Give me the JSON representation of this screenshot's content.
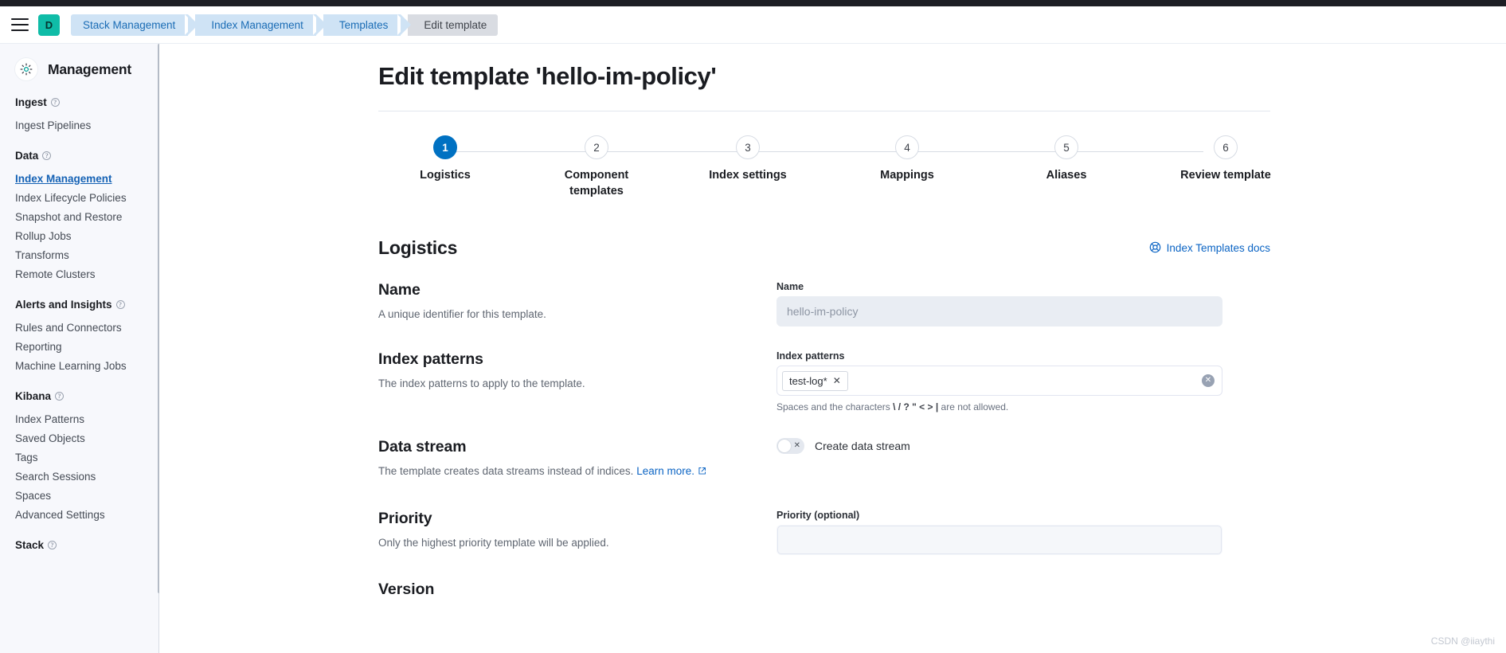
{
  "header": {
    "menu_icon": "hamburger-icon",
    "avatar_initial": "D",
    "breadcrumbs": [
      {
        "label": "Stack Management",
        "active": false
      },
      {
        "label": "Index Management",
        "active": false
      },
      {
        "label": "Templates",
        "active": false
      },
      {
        "label": "Edit template",
        "active": true
      }
    ]
  },
  "sidebar": {
    "title": "Management",
    "gear_icon": "gear-icon",
    "sections": [
      {
        "title": "Ingest",
        "help_icon": "question-icon",
        "items": [
          {
            "label": "Ingest Pipelines",
            "active": false
          }
        ]
      },
      {
        "title": "Data",
        "help_icon": "question-icon",
        "items": [
          {
            "label": "Index Management",
            "active": true
          },
          {
            "label": "Index Lifecycle Policies",
            "active": false
          },
          {
            "label": "Snapshot and Restore",
            "active": false
          },
          {
            "label": "Rollup Jobs",
            "active": false
          },
          {
            "label": "Transforms",
            "active": false
          },
          {
            "label": "Remote Clusters",
            "active": false
          }
        ]
      },
      {
        "title": "Alerts and Insights",
        "help_icon": "question-icon",
        "items": [
          {
            "label": "Rules and Connectors",
            "active": false
          },
          {
            "label": "Reporting",
            "active": false
          },
          {
            "label": "Machine Learning Jobs",
            "active": false
          }
        ]
      },
      {
        "title": "Kibana",
        "help_icon": "question-icon",
        "items": [
          {
            "label": "Index Patterns",
            "active": false
          },
          {
            "label": "Saved Objects",
            "active": false
          },
          {
            "label": "Tags",
            "active": false
          },
          {
            "label": "Search Sessions",
            "active": false
          },
          {
            "label": "Spaces",
            "active": false
          },
          {
            "label": "Advanced Settings",
            "active": false
          }
        ]
      },
      {
        "title": "Stack",
        "help_icon": "question-icon",
        "items": []
      }
    ]
  },
  "main": {
    "page_title": "Edit template 'hello-im-policy'",
    "steps": [
      {
        "number": "1",
        "label": "Logistics",
        "current": true
      },
      {
        "number": "2",
        "label": "Component templates",
        "current": false
      },
      {
        "number": "3",
        "label": "Index settings",
        "current": false
      },
      {
        "number": "4",
        "label": "Mappings",
        "current": false
      },
      {
        "number": "5",
        "label": "Aliases",
        "current": false
      },
      {
        "number": "6",
        "label": "Review template",
        "current": false
      }
    ],
    "section_title": "Logistics",
    "docs_link": {
      "label": "Index Templates docs",
      "icon": "help-lifebuoy-icon"
    },
    "rows": {
      "name": {
        "title": "Name",
        "description": "A unique identifier for this template.",
        "field_label": "Name",
        "value": "hello-im-policy",
        "disabled": true
      },
      "index_patterns": {
        "title": "Index patterns",
        "description": "The index patterns to apply to the template.",
        "field_label": "Index patterns",
        "pills": [
          "test-log*"
        ],
        "clear_icon": "clear-circle-icon",
        "helper_prefix": "Spaces and the characters",
        "helper_chars": "\\ / ? \" < > |",
        "helper_suffix": "are not allowed."
      },
      "data_stream": {
        "title": "Data stream",
        "description": "The template creates data streams instead of indices.",
        "learn_more": "Learn more.",
        "external_icon": "external-link-icon",
        "toggle_label": "Create data stream",
        "toggle_on": false,
        "toggle_icon": "cross-icon"
      },
      "priority": {
        "title": "Priority",
        "description": "Only the highest priority template will be applied.",
        "field_label": "Priority (optional)",
        "value": ""
      },
      "version_partial": {
        "title": "Version"
      }
    }
  },
  "watermark": "CSDN @iiaythi",
  "colors": {
    "accent_blue": "#0071c2",
    "link_blue": "#0b64c4",
    "avatar_teal": "#0fbca7",
    "crumb_blue": "#cfe3f5",
    "crumb_gray": "#d9dce2"
  }
}
